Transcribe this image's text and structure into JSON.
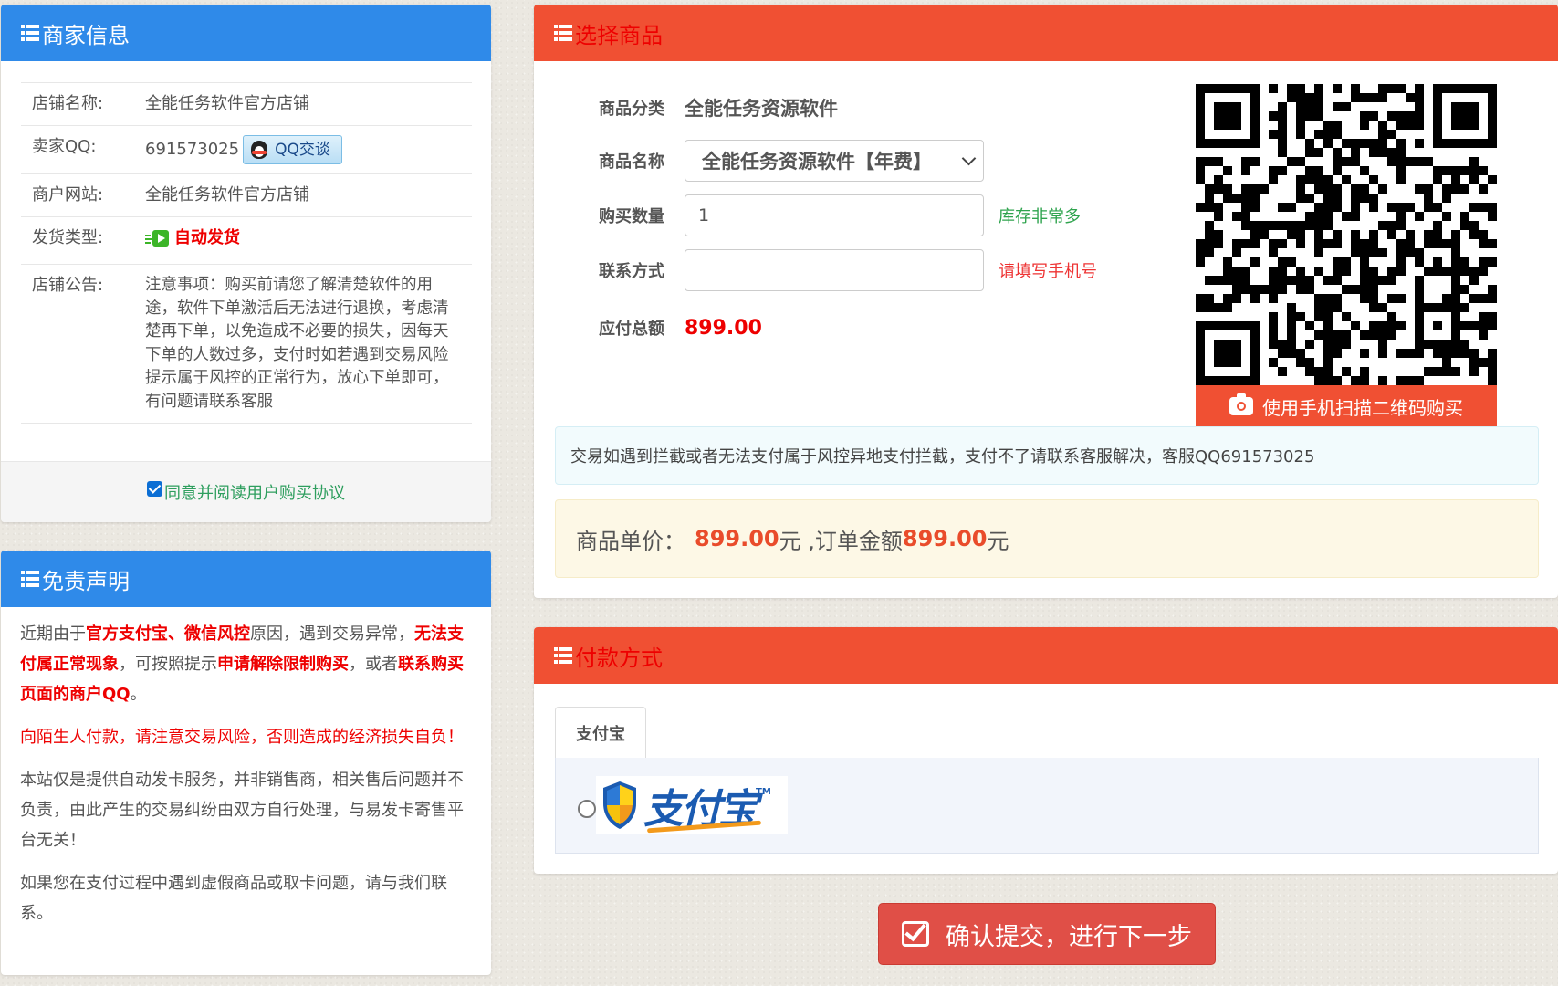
{
  "merchant": {
    "header": "商家信息",
    "rows": [
      {
        "label": "店铺名称:",
        "value": "全能任务软件官方店铺"
      },
      {
        "label": "卖家QQ:",
        "value": "691573025",
        "button": "QQ交谈"
      },
      {
        "label": "商户网站:",
        "value": "全能任务软件官方店铺"
      },
      {
        "label": "发货类型:",
        "value": "自动发货"
      },
      {
        "label": "店铺公告:",
        "value": "注意事项：购买前请您了解清楚软件的用途，软件下单激活后无法进行退换，考虑清楚再下单，以免造成不必要的损失，因每天下单的人数过多，支付时如若遇到交易风险提示属于风控的正常行为，放心下单即可，有问题请联系客服"
      }
    ],
    "agree_label": "同意并阅读用户购买协议"
  },
  "disclaimer": {
    "header": "免责声明",
    "p1": [
      "近期由于",
      "官方支付宝、微信风控",
      "原因，遇到交易异常，",
      "无法支付属正常现象",
      "，可按照提示",
      "申请解除限制购买",
      "，或者",
      "联系购买页面的商户QQ",
      "。"
    ],
    "p2": "向陌生人付款，请注意交易风险，否则造成的经济损失自负！",
    "p3": "本站仅是提供自动发卡服务，并非销售商，相关售后问题并不负责，由此产生的交易纠纷由双方自行处理，与易发卡寄售平台无关！",
    "p4": "如果您在支付过程中遇到虚假商品或取卡问题，请与我们联系。"
  },
  "goods": {
    "header": "选择商品",
    "category_label": "商品分类",
    "category_value": "全能任务资源软件",
    "name_label": "商品名称",
    "name_value": "全能任务资源软件【年费】",
    "qty_label": "购买数量",
    "qty_value": "1",
    "stock_hint": "库存非常多",
    "contact_label": "联系方式",
    "contact_value": "",
    "contact_hint": "请填写手机号",
    "total_label": "应付总额",
    "total_value": "899.00",
    "qr_caption": "使用手机扫描二维码购买",
    "notice": "交易如遇到拦截或者无法支付属于风控异地支付拦截，支付不了请联系客服解决，客服QQ691573025",
    "summary": {
      "unit_label": "商品单价：",
      "unit_price": "899.00",
      "unit_suffix": "元 ,订单金额",
      "order_amount": "899.00",
      "order_suffix": "元"
    }
  },
  "payment": {
    "header": "付款方式",
    "tab": "支付宝",
    "logo_text": "支付宝",
    "logo_tm": "TM"
  },
  "submit_label": "确认提交，进行下一步",
  "colors": {
    "blue_header": "#2f8ae9",
    "red_header": "#f05033",
    "price_red": "#e00000",
    "submit": "#e04f47"
  },
  "icons": [
    "list-icon",
    "qq-penguin-icon",
    "auto-ship-icon",
    "checkbox-icon",
    "select-chevron-icon",
    "qr-code",
    "camera-icon",
    "alipay-shield-icon",
    "check-square-icon"
  ]
}
